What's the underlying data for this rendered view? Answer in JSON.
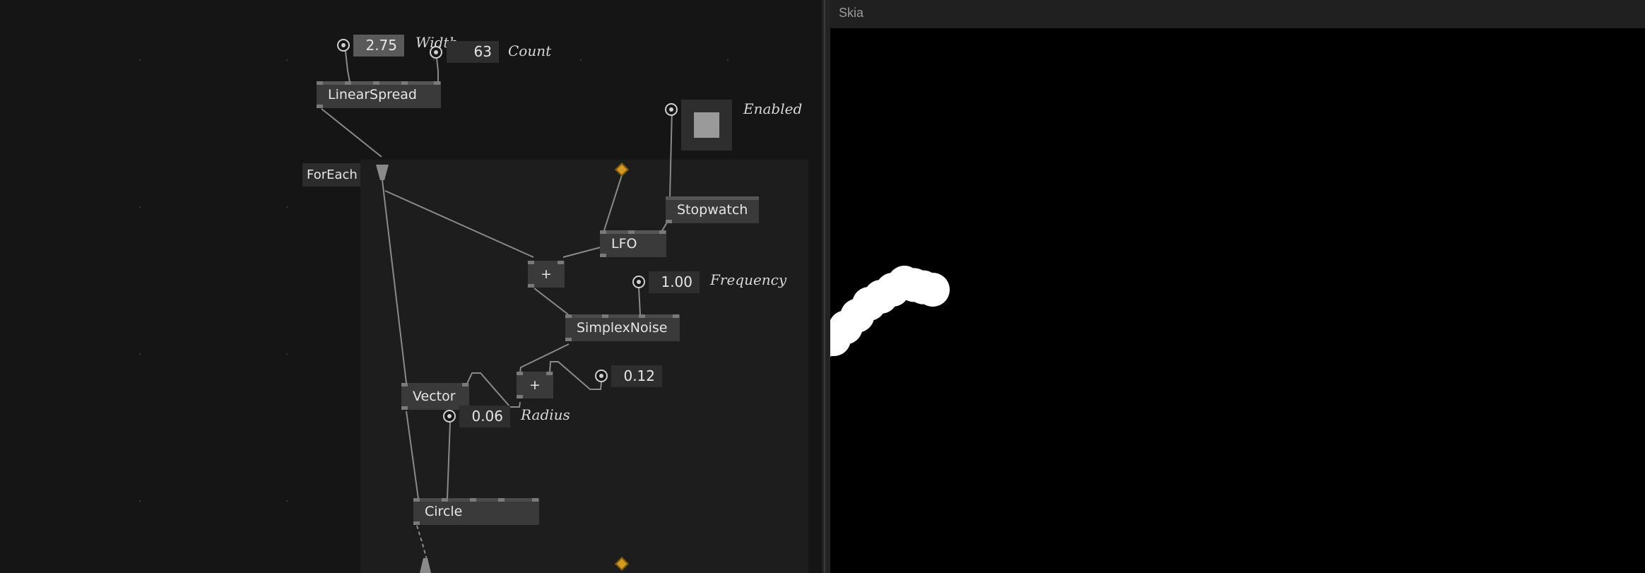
{
  "patch": {
    "nodes": {
      "linear_spread": "LinearSpread",
      "for_each": "ForEach",
      "stopwatch": "Stopwatch",
      "lfo": "LFO",
      "plus1": "+",
      "simplex_noise": "SimplexNoise",
      "plus2": "+",
      "vector": "Vector",
      "circle": "Circle"
    },
    "iobox": {
      "width_value": "2.75",
      "width_label": "Width",
      "count_value": "63",
      "count_label": "Count",
      "enabled_label": "Enabled",
      "frequency_value": "1.00",
      "frequency_label": "Frequency",
      "offset_value": "0.12",
      "radius_value": "0.06",
      "radius_label": "Radius"
    },
    "colors": {
      "background": "#151515",
      "region": "#1d1d1d",
      "node": "#3a3a3a",
      "pin": "#7a7a7a",
      "accent_diamond": "#d49a22"
    }
  },
  "renderer": {
    "title": "Skia",
    "circle_color": "#ffffff",
    "background": "#000000"
  }
}
